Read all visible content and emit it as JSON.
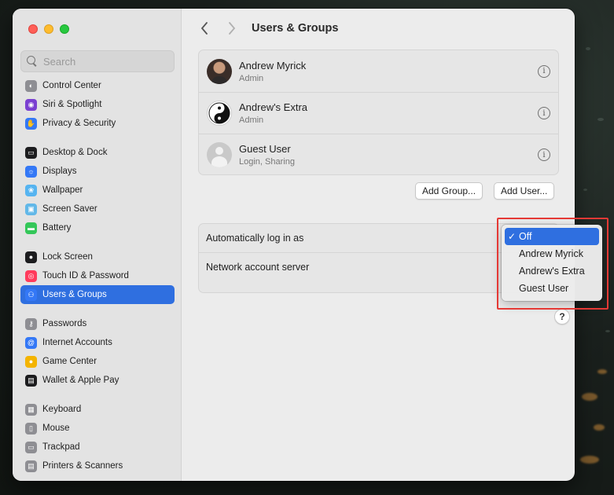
{
  "window": {
    "title": "Users & Groups"
  },
  "search": {
    "placeholder": "Search"
  },
  "sidebar": {
    "groups": [
      [
        {
          "label": "Control Center",
          "icon": "control-center-icon",
          "color": "#8e8e93"
        },
        {
          "label": "Siri & Spotlight",
          "icon": "siri-icon",
          "color": "#7a3fd1"
        },
        {
          "label": "Privacy & Security",
          "icon": "hand-icon",
          "color": "#3478f6"
        }
      ],
      [
        {
          "label": "Desktop & Dock",
          "icon": "dock-icon",
          "color": "#1c1c1e"
        },
        {
          "label": "Displays",
          "icon": "displays-icon",
          "color": "#3478f6"
        },
        {
          "label": "Wallpaper",
          "icon": "wallpaper-icon",
          "color": "#56b4f0"
        },
        {
          "label": "Screen Saver",
          "icon": "screen-saver-icon",
          "color": "#62b8e8"
        },
        {
          "label": "Battery",
          "icon": "battery-icon",
          "color": "#34c759"
        }
      ],
      [
        {
          "label": "Lock Screen",
          "icon": "lock-icon",
          "color": "#1c1c1e"
        },
        {
          "label": "Touch ID & Password",
          "icon": "fingerprint-icon",
          "color": "#ff3b5c"
        },
        {
          "label": "Users & Groups",
          "icon": "users-icon",
          "color": "#3478f6",
          "selected": true
        }
      ],
      [
        {
          "label": "Passwords",
          "icon": "key-icon",
          "color": "#8e8e93"
        },
        {
          "label": "Internet Accounts",
          "icon": "at-icon",
          "color": "#3478f6"
        },
        {
          "label": "Game Center",
          "icon": "game-center-icon",
          "color": "#f4b400"
        },
        {
          "label": "Wallet & Apple Pay",
          "icon": "wallet-icon",
          "color": "#1c1c1e"
        }
      ],
      [
        {
          "label": "Keyboard",
          "icon": "keyboard-icon",
          "color": "#8e8e93"
        },
        {
          "label": "Mouse",
          "icon": "mouse-icon",
          "color": "#8e8e93"
        },
        {
          "label": "Trackpad",
          "icon": "trackpad-icon",
          "color": "#8e8e93"
        },
        {
          "label": "Printers & Scanners",
          "icon": "printer-icon",
          "color": "#8e8e93"
        }
      ]
    ]
  },
  "users": [
    {
      "name": "Andrew Myrick",
      "role": "Admin",
      "avatar": "photo"
    },
    {
      "name": "Andrew's Extra",
      "role": "Admin",
      "avatar": "yin-yang"
    },
    {
      "name": "Guest User",
      "role": "Login, Sharing",
      "avatar": "guest"
    }
  ],
  "buttons": {
    "add_group": "Add Group...",
    "add_user": "Add User..."
  },
  "settings": {
    "auto_login_label": "Automatically log in as",
    "network_server_label": "Network account server"
  },
  "dropdown": {
    "options": [
      "Off",
      "Andrew Myrick",
      "Andrew's Extra",
      "Guest User"
    ],
    "selected_index": 0
  },
  "help": {
    "label": "?"
  },
  "colors": {
    "accent": "#2f6fe0",
    "highlight": "#e53935"
  }
}
